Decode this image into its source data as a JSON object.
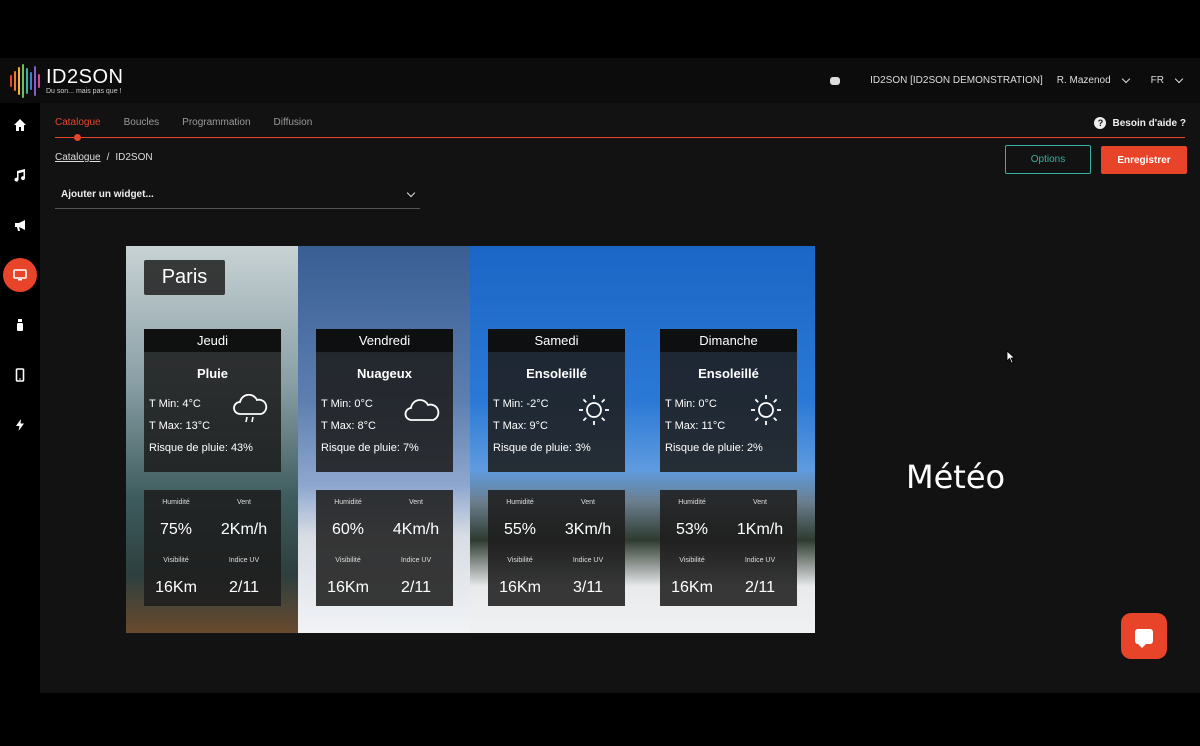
{
  "brand": {
    "name": "ID2SON",
    "tagline": "Du son... mais pas que !"
  },
  "header": {
    "account": "ID2SON [ID2SON DEMONSTRATION]",
    "user": "R. Mazenod",
    "language": "FR"
  },
  "sidebar": {
    "items": [
      {
        "icon": "home-icon"
      },
      {
        "icon": "music-note-icon"
      },
      {
        "icon": "megaphone-icon"
      },
      {
        "icon": "monitor-icon",
        "active": true
      },
      {
        "icon": "spray-bottle-icon"
      },
      {
        "icon": "phone-icon"
      },
      {
        "icon": "lightning-icon"
      }
    ]
  },
  "tabs": [
    "Catalogue",
    "Boucles",
    "Programmation",
    "Diffusion"
  ],
  "active_tab": "Catalogue",
  "help_label": "Besoin d'aide ?",
  "breadcrumb": {
    "root": "Catalogue",
    "separator": "/",
    "current": "ID2SON"
  },
  "buttons": {
    "options": "Options",
    "save": "Enregistrer"
  },
  "widget_select": {
    "value": "Ajouter un widget..."
  },
  "preview": {
    "city": "Paris",
    "days": [
      {
        "day": "Jeudi",
        "condition": "Pluie",
        "icon": "rain-cloud-icon",
        "tmin": "T Min: 4°C",
        "tmax": "T Max: 13°C",
        "rain": "Risque de pluie: 43%",
        "humidity_label": "Humidité",
        "humidity": "75%",
        "wind_label": "Vent",
        "wind": "2Km/h",
        "visibility_label": "Visibilité",
        "visibility": "16Km",
        "uv_label": "Indice UV",
        "uv": "2/11"
      },
      {
        "day": "Vendredi",
        "condition": "Nuageux",
        "icon": "cloud-icon",
        "tmin": "T Min: 0°C",
        "tmax": "T Max: 8°C",
        "rain": "Risque de pluie: 7%",
        "humidity_label": "Humidité",
        "humidity": "60%",
        "wind_label": "Vent",
        "wind": "4Km/h",
        "visibility_label": "Visibilité",
        "visibility": "16Km",
        "uv_label": "Indice UV",
        "uv": "2/11"
      },
      {
        "day": "Samedi",
        "condition": "Ensoleillé",
        "icon": "sun-icon",
        "tmin": "T Min: -2°C",
        "tmax": "T Max: 9°C",
        "rain": "Risque de pluie: 3%",
        "humidity_label": "Humidité",
        "humidity": "55%",
        "wind_label": "Vent",
        "wind": "3Km/h",
        "visibility_label": "Visibilité",
        "visibility": "16Km",
        "uv_label": "Indice UV",
        "uv": "3/11"
      },
      {
        "day": "Dimanche",
        "condition": "Ensoleillé",
        "icon": "sun-icon",
        "tmin": "T Min: 0°C",
        "tmax": "T Max: 11°C",
        "rain": "Risque de pluie: 2%",
        "humidity_label": "Humidité",
        "humidity": "53%",
        "wind_label": "Vent",
        "wind": "1Km/h",
        "visibility_label": "Visibilité",
        "visibility": "16Km",
        "uv_label": "Indice UV",
        "uv": "2/11"
      }
    ]
  },
  "widget_title": "Météo",
  "colors": {
    "accent": "#e8442a",
    "options_border": "#3ab0a0",
    "panel": "#121212"
  }
}
